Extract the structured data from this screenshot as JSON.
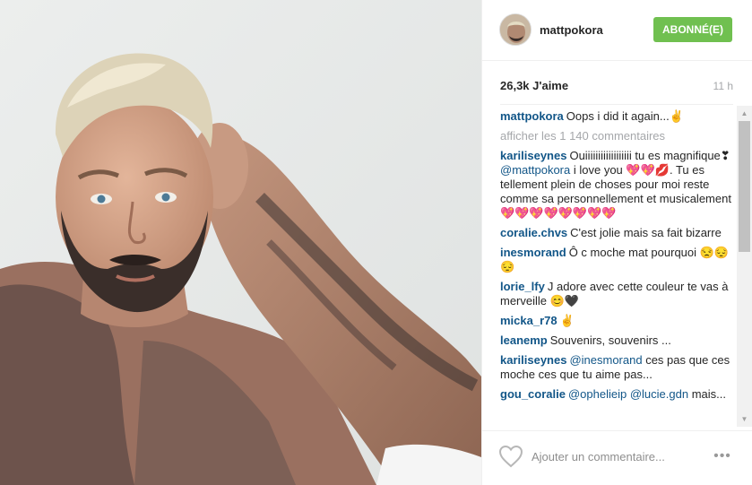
{
  "post": {
    "username": "mattpokora",
    "follow_label": "ABONNÉ(E)",
    "likes": "26,3k J'aime",
    "time_ago": "11 h",
    "caption_user": "mattpokora",
    "caption_text": "Oops i did it again...✌",
    "load_more": "afficher les 1 140 commentaires",
    "comment_placeholder": "Ajouter un commentaire...",
    "more_label": "•••",
    "like_icon": "heart-outline-icon"
  },
  "comments": [
    {
      "user": "kariliseynes",
      "pre": "Ouiiiiiiiiiiiiiiiiii tu es magnifique❣",
      "mention": "@mattpokora",
      "post": "i love you 💖💖💋. Tu es tellement plein de choses pour moi reste comme sa personnellement et musicalement 💖💖💖💖💖💖💖💖"
    },
    {
      "user": "coralie.chvs",
      "pre": "C'est jolie mais sa fait bizarre",
      "mention": "",
      "post": ""
    },
    {
      "user": "inesmorand",
      "pre": "Ô c moche mat pourquoi 😒😔😔",
      "mention": "",
      "post": ""
    },
    {
      "user": "lorie_lfy",
      "pre": "J adore avec cette couleur te vas à merveille 😊🖤",
      "mention": "",
      "post": ""
    },
    {
      "user": "micka_r78",
      "pre": "✌",
      "mention": "",
      "post": ""
    },
    {
      "user": "leanemp",
      "pre": "Souvenirs, souvenirs ...",
      "mention": "",
      "post": ""
    },
    {
      "user": "kariliseynes",
      "pre": "",
      "mention": "@inesmorand",
      "post": "ces pas que ces moche ces que tu aime pas..."
    },
    {
      "user": "gou_coralie",
      "pre": "",
      "mention": "@ophelieip @lucie.gdn",
      "post": "mais..."
    }
  ],
  "colors": {
    "follow_green": "#70c050",
    "link_blue": "#125688",
    "muted_gray": "#a5a7aa",
    "border": "#efefef"
  }
}
